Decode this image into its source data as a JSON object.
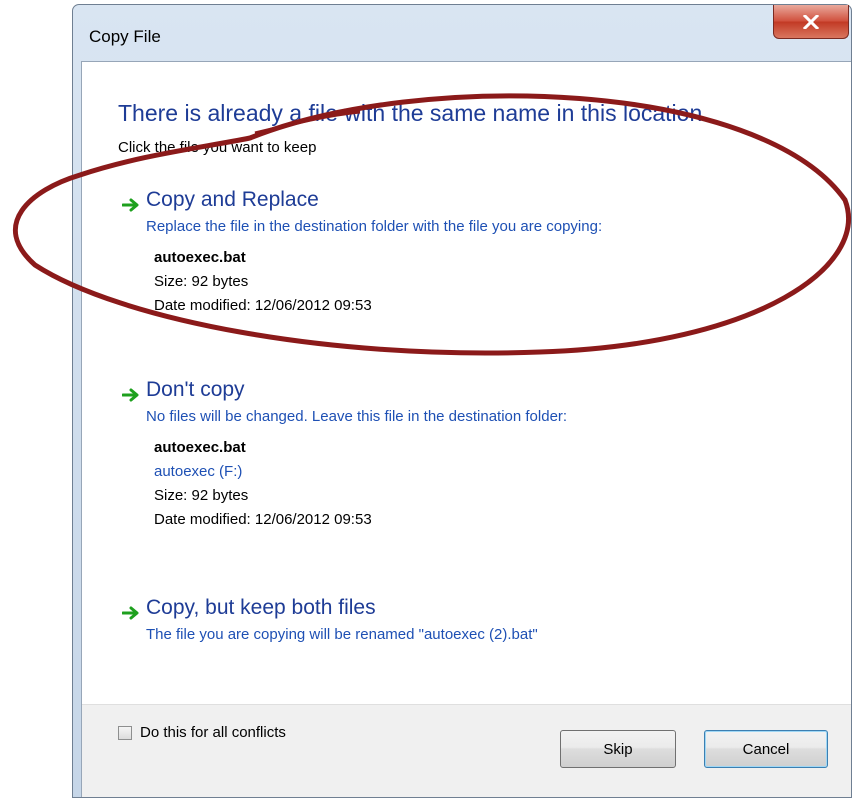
{
  "window": {
    "title": "Copy File",
    "close_label": "X"
  },
  "dialog": {
    "headline": "There is already a file with the same name in this location.",
    "subhead": "Click the file you want to keep"
  },
  "options": [
    {
      "title": "Copy and Replace",
      "description": "Replace the file in the destination folder with the file you are copying:",
      "file": {
        "name": "autoexec.bat",
        "size": "Size: 92 bytes",
        "date_modified": "Date modified: 12/06/2012 09:53"
      }
    },
    {
      "title": "Don't copy",
      "description": "No files will be changed. Leave this file in the destination folder:",
      "file": {
        "name": "autoexec.bat",
        "location": "autoexec (F:)",
        "size": "Size: 92 bytes",
        "date_modified": "Date modified: 12/06/2012 09:53"
      }
    },
    {
      "title": "Copy, but keep both files",
      "description": "The file you are copying will be renamed \"autoexec (2).bat\""
    }
  ],
  "footer": {
    "checkbox_label": "Do this for all conflicts",
    "checkbox_checked": false,
    "skip_label": "Skip",
    "cancel_label": "Cancel"
  },
  "icons": {
    "option_arrow": "green-arrow-icon",
    "close": "close-icon"
  },
  "colors": {
    "heading": "#1e3c96",
    "link": "#1e50b4",
    "arrow": "#1ea01e",
    "annotation": "#8b1a1a",
    "close_button": "#c9432f"
  }
}
